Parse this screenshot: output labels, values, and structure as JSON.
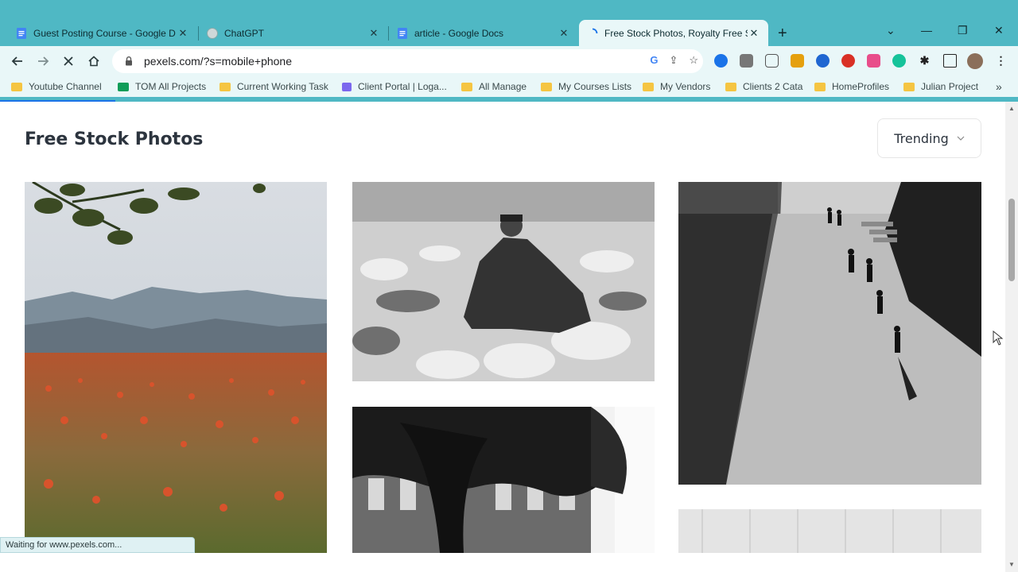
{
  "tabs": [
    {
      "title": "Guest Posting Course - Google D",
      "icon": "google-docs-icon",
      "active": false
    },
    {
      "title": "ChatGPT",
      "icon": "chatgpt-icon",
      "active": false
    },
    {
      "title": "article - Google Docs",
      "icon": "google-docs-icon",
      "active": false
    },
    {
      "title": "Free Stock Photos, Royalty Free S",
      "icon": "loading-spinner-icon",
      "active": true
    }
  ],
  "tab_close_label": "✕",
  "newtab_label": "+",
  "window_controls": {
    "dropdown": "⌄",
    "minimize": "—",
    "restore": "❐",
    "close": "✕"
  },
  "address_bar": {
    "url": "pexels.com/?s=mobile+phone"
  },
  "bookmarks": [
    {
      "label": "Youtube Channel",
      "icon": "folder-icon"
    },
    {
      "label": "TOM All Projects",
      "icon": "sheets-icon"
    },
    {
      "label": "Current Working Task",
      "icon": "folder-icon"
    },
    {
      "label": "Client Portal | Loga...",
      "icon": "clickup-icon"
    },
    {
      "label": "All Manage",
      "icon": "folder-icon"
    },
    {
      "label": "My Courses Lists",
      "icon": "folder-icon"
    },
    {
      "label": "My Vendors",
      "icon": "folder-icon"
    },
    {
      "label": "Clients 2 Cata",
      "icon": "folder-icon"
    },
    {
      "label": "HomeProfiles",
      "icon": "folder-icon"
    },
    {
      "label": "Julian Project",
      "icon": "folder-icon"
    }
  ],
  "bookmarks_more": "»",
  "page": {
    "title": "Free Stock Photos",
    "sort_label": "Trending"
  },
  "status_text": "Waiting for www.pexels.com...",
  "colors": {
    "chrome": "#4fb8c4",
    "toolbar": "#e9f7f8",
    "accent": "#1a73e8"
  }
}
